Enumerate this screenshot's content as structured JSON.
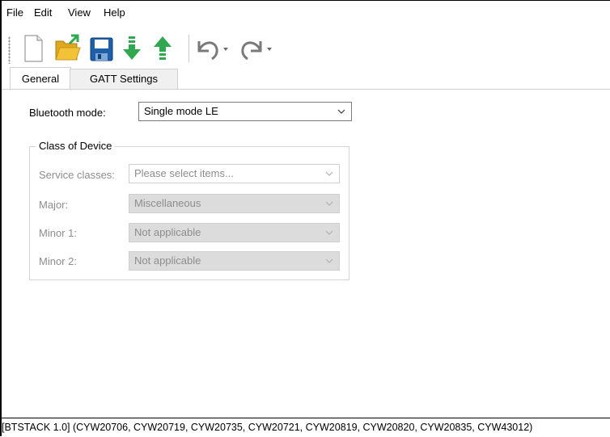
{
  "menu": [
    "File",
    "Edit",
    "View",
    "Help"
  ],
  "toolbar_icons": [
    "new-file-icon",
    "open-folder-icon",
    "save-icon",
    "import-icon",
    "export-icon",
    "undo-icon",
    "redo-icon"
  ],
  "tabs": [
    {
      "label": "General",
      "active": true
    },
    {
      "label": "GATT Settings",
      "active": false
    }
  ],
  "general": {
    "bluetooth_mode_label": "Bluetooth mode:",
    "bluetooth_mode_value": "Single mode LE",
    "class_of_device": {
      "title": "Class of Device",
      "service_classes_label": "Service classes:",
      "service_classes_value": "Please select items...",
      "major_label": "Major:",
      "major_value": "Miscellaneous",
      "minor1_label": "Minor 1:",
      "minor1_value": "Not applicable",
      "minor2_label": "Minor 2:",
      "minor2_value": "Not applicable"
    }
  },
  "status": "[BTSTACK 1.0] (CYW20706, CYW20719, CYW20735, CYW20721, CYW20819, CYW20820, CYW20835, CYW43012)",
  "colors": {
    "disabled_text": "#8d8d8d",
    "disabled_field": "#dcdcdc",
    "open_icon": "#f2c336",
    "save_icon": "#1d5fa8",
    "import_icon": "#2fa84f"
  }
}
